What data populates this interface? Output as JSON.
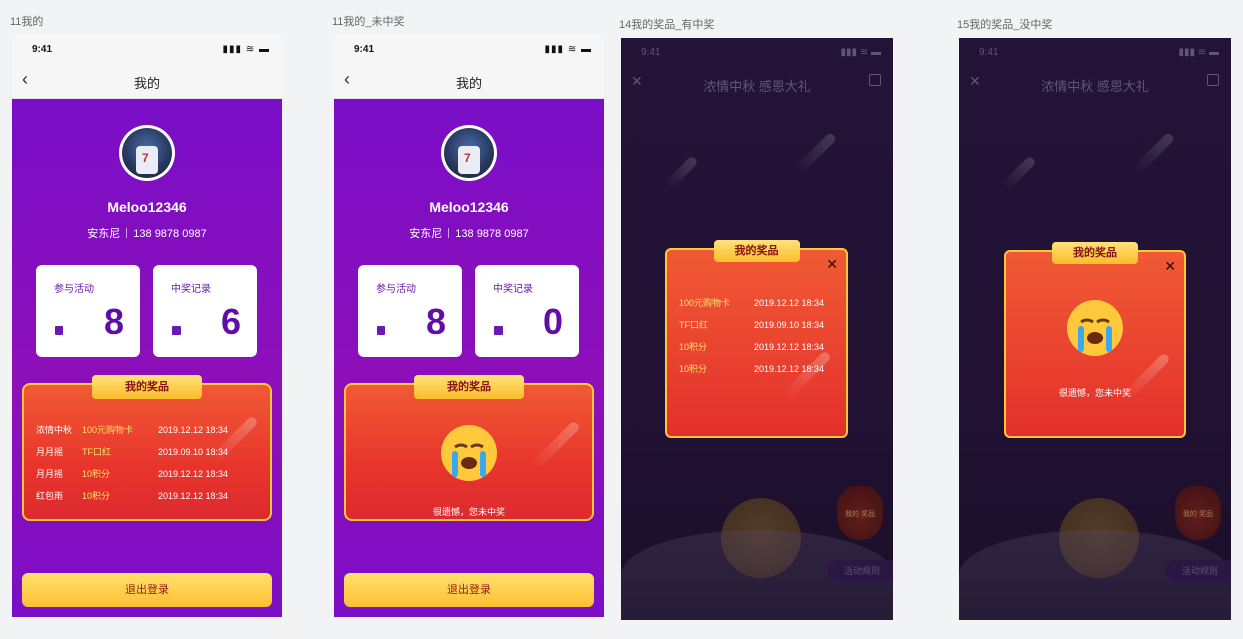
{
  "screens": [
    {
      "caption": "11我的",
      "status_time": "9:41",
      "status_icons": "▮▮▮ ≋ ▬",
      "back_icon": "‹",
      "title": "我的",
      "username": "Meloo12346",
      "realname": "安东尼",
      "phone": "138 9878 0987",
      "stat1_label": "参与活动",
      "stat1_value": "8",
      "stat2_label": "中奖记录",
      "stat2_value": "6",
      "prize_title": "我的奖品",
      "rows": [
        {
          "activity": "浓情中秋",
          "prize": "100元购物卡",
          "time": "2019.12.12 18:34"
        },
        {
          "activity": "月月摇",
          "prize": "TF口红",
          "time": "2019.09.10 18:34"
        },
        {
          "activity": "月月摇",
          "prize": "10积分",
          "time": "2019.12.12 18:34"
        },
        {
          "activity": "红包雨",
          "prize": "10积分",
          "time": "2019.12.12 18:34"
        }
      ],
      "logout": "退出登录"
    },
    {
      "caption": "11我的_未中奖",
      "status_time": "9:41",
      "status_icons": "▮▮▮ ≋ ▬",
      "back_icon": "‹",
      "title": "我的",
      "username": "Meloo12346",
      "realname": "安东尼",
      "phone": "138 9878 0987",
      "stat1_label": "参与活动",
      "stat1_value": "8",
      "stat2_label": "中奖记录",
      "stat2_value": "0",
      "prize_title": "我的奖品",
      "sorry": "很遗憾，您未中奖",
      "logout": "退出登录"
    },
    {
      "caption": "14我的奖品_有中奖",
      "status_time": "9:41",
      "status_icons": "▮▮▮ ≋ ▬",
      "close_icon": "✕",
      "title": "浓情中秋  感恩大礼",
      "modal_title": "我的奖品",
      "modal_close": "✕",
      "rows": [
        {
          "prize": "100元购物卡",
          "time": "2019.12.12 18:34"
        },
        {
          "prize": "TF口红",
          "time": "2019.09.10 18:34"
        },
        {
          "prize": "10积分",
          "time": "2019.12.12 18:34"
        },
        {
          "prize": "10积分",
          "time": "2019.12.12 18:34"
        }
      ],
      "bag_label": "我的\n奖品",
      "rules": "活动规则"
    },
    {
      "caption": "15我的奖品_没中奖",
      "status_time": "9:41",
      "status_icons": "▮▮▮ ≋ ▬",
      "close_icon": "✕",
      "title": "浓情中秋  感恩大礼",
      "modal_title": "我的奖品",
      "modal_close": "✕",
      "sorry": "很遗憾，您未中奖",
      "bag_label": "我的\n奖品",
      "rules": "活动规则"
    }
  ],
  "colors": {
    "purple": "#7a0ec8",
    "red": "#e8352c",
    "gold": "#ffc837",
    "dark_bg": "#2b1a45"
  }
}
